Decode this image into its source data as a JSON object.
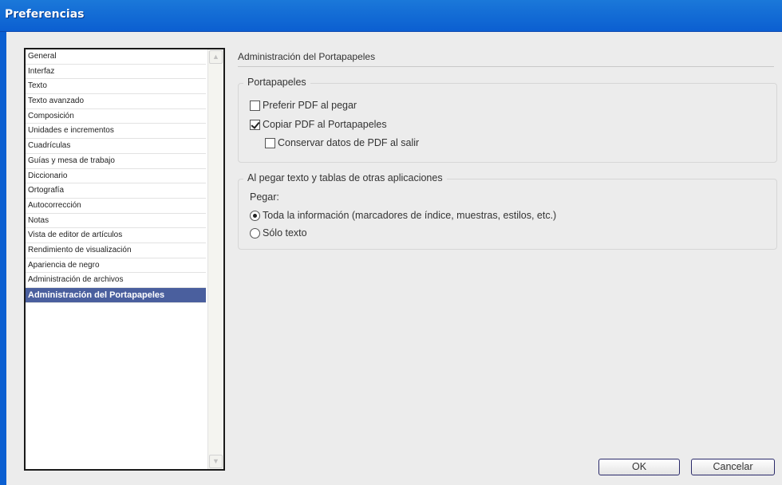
{
  "window": {
    "title": "Preferencias"
  },
  "categories": [
    "General",
    "Interfaz",
    "Texto",
    "Texto avanzado",
    "Composición",
    "Unidades e incrementos",
    "Cuadrículas",
    "Guías y mesa de trabajo",
    "Diccionario",
    "Ortografía",
    "Autocorrección",
    "Notas",
    "Vista de editor de artículos",
    "Rendimiento de visualización",
    "Apariencia de negro",
    "Administración de archivos",
    "Administración del Portapapeles"
  ],
  "selected_category": "Administración del Portapapeles",
  "panel": {
    "heading": "Administración del Portapapeles",
    "clipboard_group": {
      "title": "Portapapeles",
      "prefer_pdf": {
        "label": "Preferir PDF al pegar",
        "checked": false
      },
      "copy_pdf": {
        "label": "Copiar PDF al Portapapeles",
        "checked": true
      },
      "keep_pdf": {
        "label": "Conservar datos de PDF al salir",
        "checked": false
      }
    },
    "paste_group": {
      "title": "Al pegar texto y tablas de otras aplicaciones",
      "paste_label": "Pegar:",
      "all_info": {
        "label": "Toda la información (marcadores de índice, muestras, estilos, etc.)",
        "selected": true
      },
      "text_only": {
        "label": "Sólo texto",
        "selected": false
      }
    }
  },
  "buttons": {
    "ok": "OK",
    "cancel": "Cancelar"
  }
}
